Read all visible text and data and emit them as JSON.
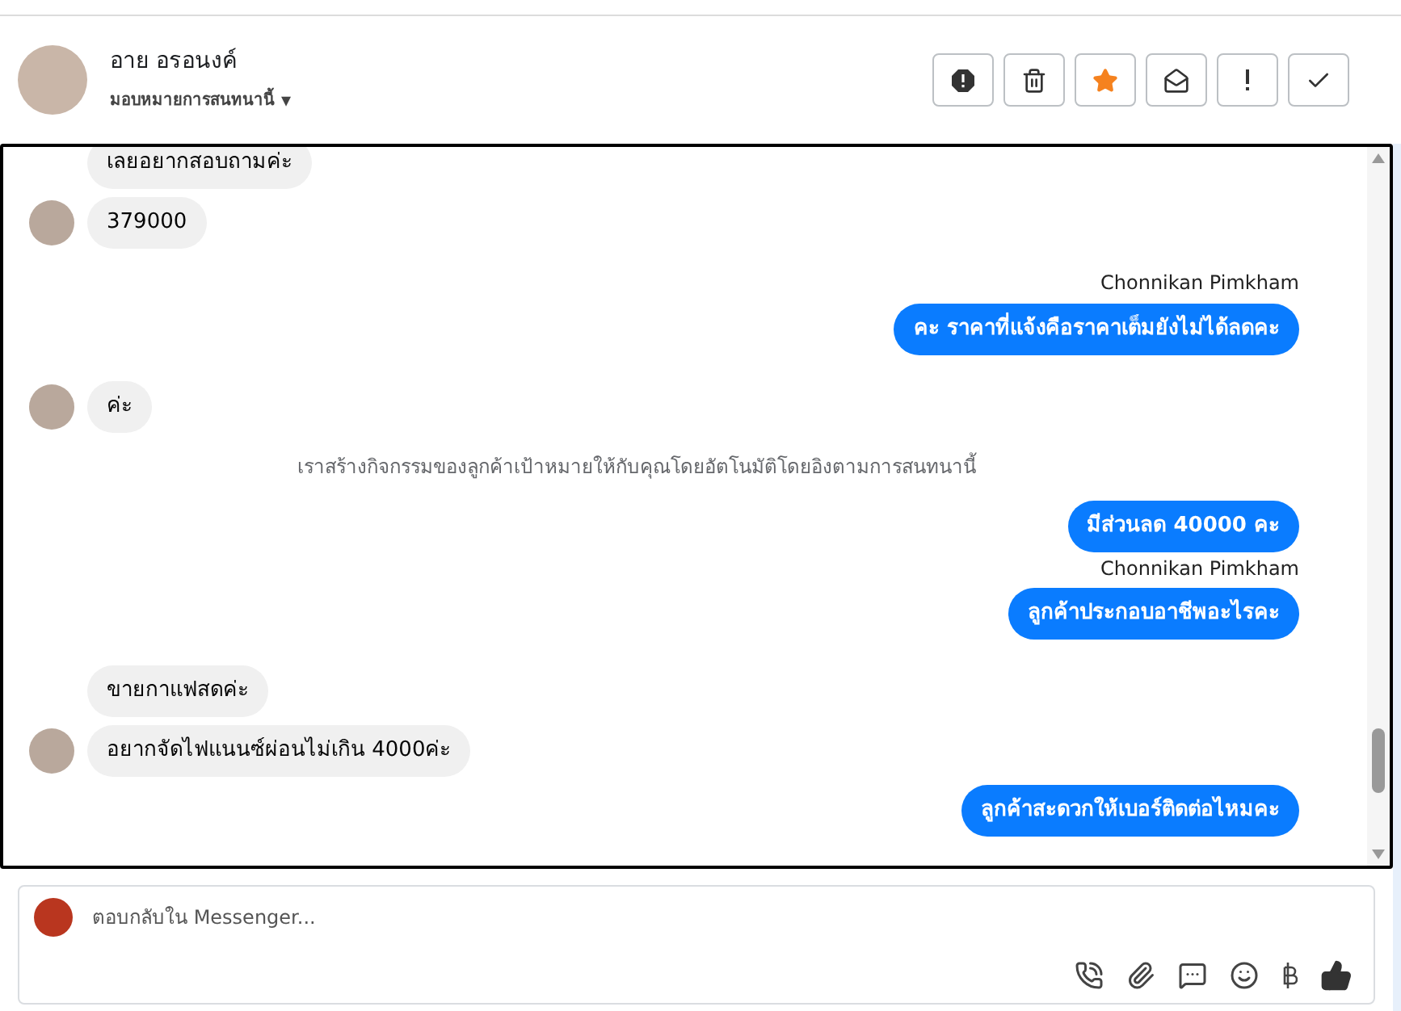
{
  "contact": {
    "name": "อาย อรอนงค์",
    "assign": "มอบหมายการสนทนานี้",
    "caret": "▾"
  },
  "actions": [
    {
      "kind": "alert",
      "on": false
    },
    {
      "kind": "trash",
      "on": false
    },
    {
      "kind": "star",
      "on": true
    },
    {
      "kind": "mail",
      "on": false
    },
    {
      "kind": "exclaim",
      "on": false
    },
    {
      "kind": "check",
      "on": false
    }
  ],
  "messages": [
    {
      "kind": "in",
      "text": "เลยอยากสอบถามค่ะ",
      "avatar": false
    },
    {
      "kind": "in",
      "text": "379000",
      "avatar": true
    },
    {
      "kind": "out",
      "sender": "Chonnikan Pimkham",
      "text": "คะ ราคาที่แจ้งคือราคาเต็มยังไม่ได้ลดคะ"
    },
    {
      "kind": "in",
      "text": "ค่ะ",
      "avatar": true
    },
    {
      "kind": "system",
      "text": "เราสร้างกิจกรรมของลูกค้าเป้าหมายให้กับคุณโดยอัตโนมัติโดยอิงตามการสนทนานี้"
    },
    {
      "kind": "out",
      "text": "มีส่วนลด 40000 คะ"
    },
    {
      "kind": "out",
      "sender": "Chonnikan Pimkham",
      "text": "ลูกค้าประกอบอาชีพอะไรคะ"
    },
    {
      "kind": "in",
      "text": "ขายกาแฟสดค่ะ",
      "avatar": false
    },
    {
      "kind": "in",
      "text": "อยากจัดไฟแนนซ์ผ่อนไม่เกิน 4000ค่ะ",
      "avatar": true
    },
    {
      "kind": "out",
      "text": "ลูกค้าสะดวกให้เบอร์ติดต่อไหมคะ"
    }
  ],
  "composer": {
    "placeholder": "ตอบกลับใน Messenger..."
  }
}
